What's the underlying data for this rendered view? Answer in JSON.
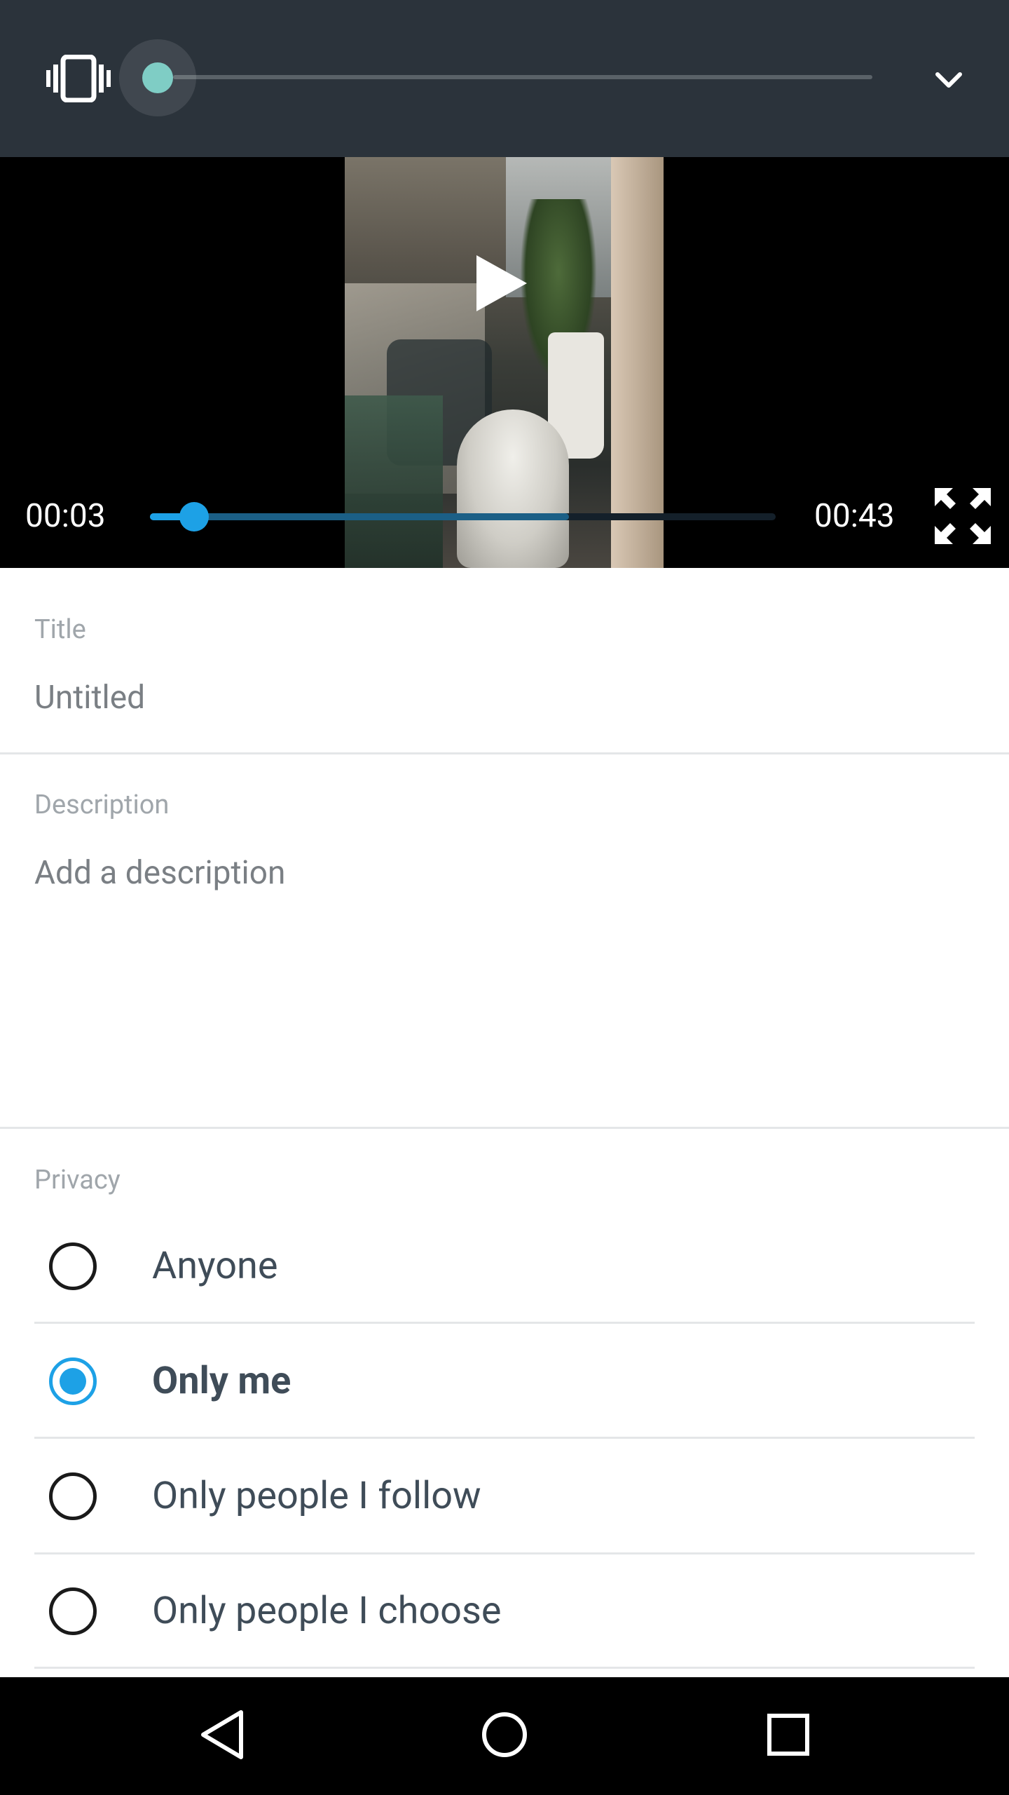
{
  "volume": {
    "icon": "vibrate-icon",
    "level": 0,
    "collapse_icon": "chevron-down-icon"
  },
  "player": {
    "current_time": "00:03",
    "total_time": "00:43",
    "progress_fraction": 0.07,
    "buffered_fraction": 0.67,
    "play_icon": "play-icon",
    "fullscreen_icon": "fullscreen-icon",
    "accent_color": "#1da1e6"
  },
  "form": {
    "title_label": "Title",
    "title_value": "Untitled",
    "description_label": "Description",
    "description_placeholder": "Add a description",
    "privacy_label": "Privacy",
    "privacy_options": [
      {
        "label": "Anyone",
        "selected": false
      },
      {
        "label": "Only me",
        "selected": true
      },
      {
        "label": "Only people I follow",
        "selected": false
      },
      {
        "label": "Only people I choose",
        "selected": false
      }
    ]
  },
  "navbar": {
    "back_icon": "back-icon",
    "home_icon": "home-icon",
    "recents_icon": "recents-icon"
  }
}
